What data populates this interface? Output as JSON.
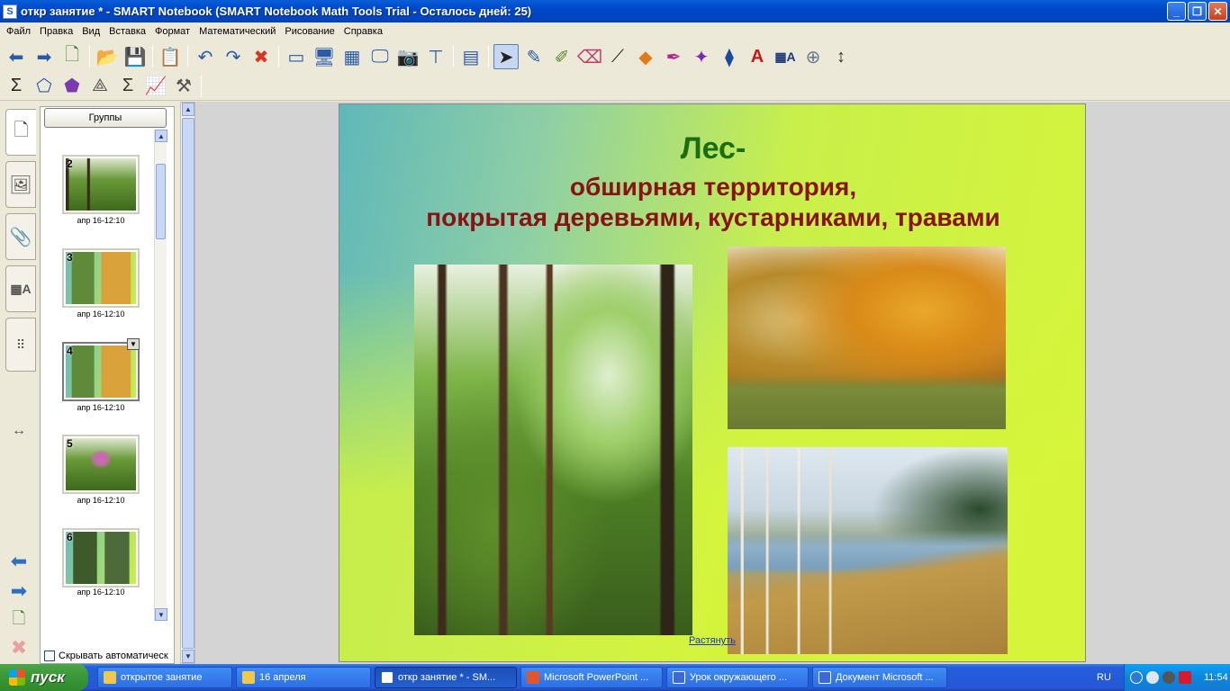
{
  "window": {
    "title": "откр занятие * - SMART Notebook (SMART Notebook Math Tools Trial - Осталось дней: 25)"
  },
  "menu": [
    "Файл",
    "Правка",
    "Вид",
    "Вставка",
    "Формат",
    "Математический",
    "Рисование",
    "Справка"
  ],
  "toolbar1_icons": [
    "back-arrow-icon",
    "forward-arrow-icon",
    "add-page-icon",
    "open-folder-icon",
    "save-icon",
    "paste-icon",
    "undo-icon",
    "redo-icon",
    "delete-icon",
    "screen-shade-icon",
    "full-screen-icon",
    "transparent-bg-icon",
    "view-screens-icon",
    "capture-icon",
    "document-camera-icon",
    "table-icon",
    "select-arrow-icon",
    "pen-icon",
    "creative-pen-icon",
    "eraser-icon",
    "line-icon",
    "shapes-icon",
    "magic-pen-icon",
    "shape-recognition-pen-icon",
    "fill-icon",
    "text-color-icon",
    "text-properties-icon",
    "math-tools-icon",
    "move-toolbar-icon"
  ],
  "toolbar2_icons": [
    "sigma-icon",
    "polygon-shape-icon",
    "geometry-shape-icon",
    "compass-icon",
    "equation-icon",
    "graph-icon",
    "hand-tools-icon"
  ],
  "sorter": {
    "groups_button": "Группы",
    "autohide_label": "Скрывать автоматическ",
    "thumbnails": [
      {
        "num": "2",
        "label": "апр 16-12:10",
        "theme": "forest"
      },
      {
        "num": "3",
        "label": "апр 16-12:10",
        "theme": "collage"
      },
      {
        "num": "4",
        "label": "апр 16-12:10",
        "theme": "collage-selected"
      },
      {
        "num": "5",
        "label": "апр 16-12:10",
        "theme": "forest-title"
      },
      {
        "num": "6",
        "label": "апр 16-12:10",
        "theme": "collage4"
      }
    ]
  },
  "slide": {
    "title_line1": "Лес-",
    "title_line2": "обширная территория,",
    "title_line3": "покрытая деревьями, кустарниками, травами",
    "link_label": "Растянуть"
  },
  "taskbar": {
    "start_label": "пуск",
    "tasks": [
      {
        "label": "открытое занятие",
        "icon": "folder-icon"
      },
      {
        "label": "16 апреля",
        "icon": "folder-icon"
      },
      {
        "label": "откр занятие * - SM...",
        "icon": "smart-notebook-icon",
        "active": true
      },
      {
        "label": "Microsoft PowerPoint ...",
        "icon": "powerpoint-icon"
      },
      {
        "label": "Урок окружающего ...",
        "icon": "word-icon"
      },
      {
        "label": "Документ Microsoft ...",
        "icon": "word-icon"
      }
    ],
    "lang": "RU",
    "clock": "11:54"
  },
  "colors": {
    "title_green": "#1b6d10",
    "title_red": "#8b1212",
    "titlebar_blue": "#0047c9",
    "taskbar_blue": "#245edb"
  }
}
